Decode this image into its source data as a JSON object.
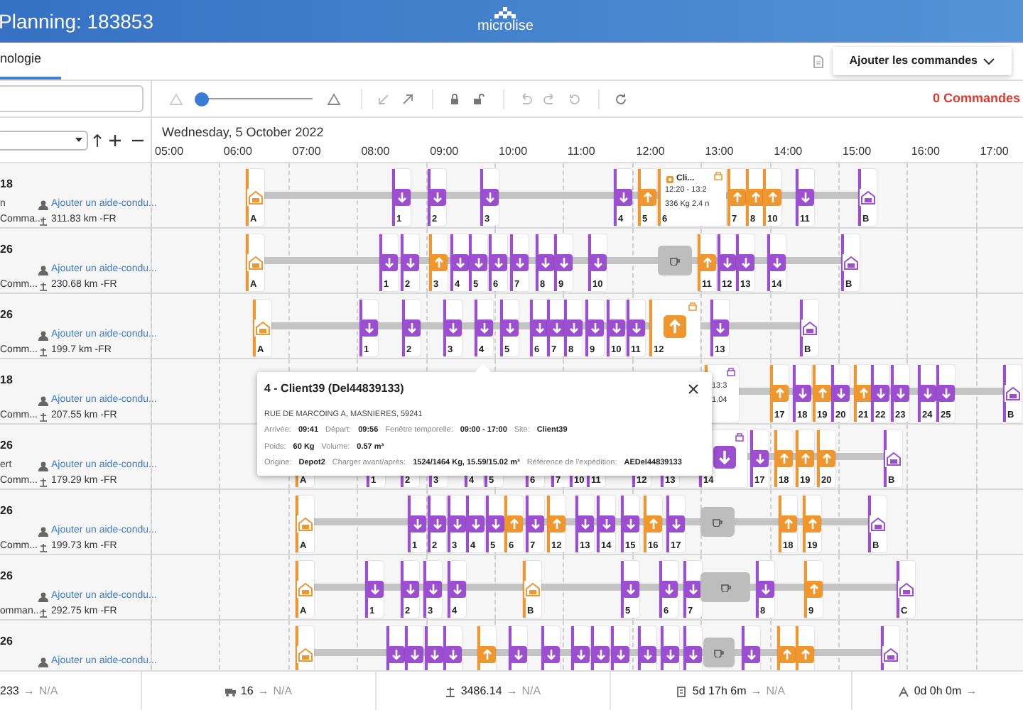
{
  "header": {
    "title": "Planning: 183853",
    "logo": "microlise"
  },
  "tabs": [
    {
      "label": "nologie",
      "selected": true
    }
  ],
  "add_orders_button": "Ajouter les commandes",
  "toolbar": {
    "zoom": {
      "level": 0
    },
    "orders_count": "0 Commandes"
  },
  "date": "Wednesday, 5 October 2022",
  "hours": [
    "05:00",
    "06:00",
    "07:00",
    "08:00",
    "09:00",
    "10:00",
    "11:00",
    "12:00",
    "13:00",
    "14:00",
    "15:00",
    "16:00",
    "17:00"
  ],
  "rows": [
    {
      "id": "18",
      "name": "n",
      "orders": "Comma...",
      "co_driver_link": "Ajouter un aide-condu...",
      "distance": "311.83 km -FR",
      "stops": [
        {
          "label": "A",
          "kind": "depot",
          "color": "#f0962f"
        },
        {
          "label": "1",
          "kind": "delivery"
        },
        {
          "label": "2",
          "kind": "delivery"
        },
        {
          "label": "3",
          "kind": "delivery"
        },
        {
          "label": "4",
          "kind": "delivery"
        },
        {
          "label": "5",
          "kind": "pickup"
        },
        {
          "label": "6",
          "kind": "detail",
          "title": "Cli...",
          "time": "12:20 - 13:2",
          "load": "336 Kg 2.4 n"
        },
        {
          "label": "7",
          "kind": "pickup"
        },
        {
          "label": "8",
          "kind": "pickup"
        },
        {
          "label": "10",
          "kind": "pickup"
        },
        {
          "label": "11",
          "kind": "delivery"
        },
        {
          "label": "B",
          "kind": "depot",
          "color": "#9b4fd0"
        }
      ]
    },
    {
      "id": "26",
      "orders": "Comm...",
      "co_driver_link": "Ajouter un aide-condu...",
      "distance": "230.68 km -FR",
      "stops": [
        {
          "label": "A",
          "kind": "depot",
          "color": "#f0962f"
        },
        {
          "label": "1",
          "kind": "delivery"
        },
        {
          "label": "2",
          "kind": "delivery"
        },
        {
          "label": "3",
          "kind": "pickup"
        },
        {
          "label": "4",
          "kind": "delivery"
        },
        {
          "label": "5",
          "kind": "delivery"
        },
        {
          "label": "6",
          "kind": "delivery"
        },
        {
          "label": "7",
          "kind": "delivery"
        },
        {
          "label": "8",
          "kind": "delivery"
        },
        {
          "label": "9",
          "kind": "delivery"
        },
        {
          "label": "10",
          "kind": "delivery"
        },
        {
          "kind": "break"
        },
        {
          "label": "11",
          "kind": "pickup"
        },
        {
          "label": "12",
          "kind": "delivery"
        },
        {
          "label": "13",
          "kind": "delivery"
        },
        {
          "label": "14",
          "kind": "delivery"
        },
        {
          "label": "B",
          "kind": "depot",
          "color": "#9b4fd0"
        }
      ]
    },
    {
      "id": "26",
      "orders": "Comm...",
      "co_driver_link": "Ajouter un aide-condu...",
      "distance": "199.7 km -FR",
      "stops": [
        {
          "label": "A",
          "kind": "depot",
          "color": "#f0962f"
        },
        {
          "label": "1",
          "kind": "delivery"
        },
        {
          "label": "2",
          "kind": "delivery"
        },
        {
          "label": "3",
          "kind": "delivery"
        },
        {
          "label": "4",
          "kind": "delivery"
        },
        {
          "label": "5",
          "kind": "delivery"
        },
        {
          "label": "6",
          "kind": "delivery"
        },
        {
          "label": "7",
          "kind": "delivery"
        },
        {
          "label": "8",
          "kind": "delivery"
        },
        {
          "label": "9",
          "kind": "delivery"
        },
        {
          "label": "10",
          "kind": "delivery"
        },
        {
          "label": "11",
          "kind": "delivery"
        },
        {
          "label": "12",
          "kind": "pickup",
          "wide": true
        },
        {
          "label": "13",
          "kind": "delivery"
        },
        {
          "label": "B",
          "kind": "depot",
          "color": "#9b4fd0"
        }
      ]
    },
    {
      "id": "18",
      "orders": "Comm...",
      "co_driver_link": "Ajouter un aide-condu...",
      "distance": "207.55 km -FR",
      "stops": [
        {
          "kind": "detail",
          "time": "13:3",
          "load": "1.04"
        },
        {
          "label": "17",
          "kind": "pickup"
        },
        {
          "label": "18",
          "kind": "delivery"
        },
        {
          "label": "19",
          "kind": "pickup"
        },
        {
          "label": "20",
          "kind": "delivery"
        },
        {
          "label": "21",
          "kind": "pickup"
        },
        {
          "label": "22",
          "kind": "delivery"
        },
        {
          "label": "23",
          "kind": "delivery"
        },
        {
          "label": "24",
          "kind": "delivery"
        },
        {
          "label": "25",
          "kind": "delivery"
        },
        {
          "label": "B",
          "kind": "depot",
          "color": "#9b4fd0"
        }
      ]
    },
    {
      "id": "26",
      "name": "ert",
      "orders": "Comm...",
      "co_driver_link": "Ajouter un aide-condu...",
      "distance": "179.29 km -FR",
      "stops": [
        {
          "label": "A",
          "kind": "depot",
          "color": "#f0962f"
        },
        {
          "label": "1",
          "kind": "delivery"
        },
        {
          "label": "2",
          "kind": "delivery"
        },
        {
          "label": "3",
          "kind": "delivery"
        },
        {
          "label": "4",
          "kind": "delivery"
        },
        {
          "label": "5",
          "kind": "delivery"
        },
        {
          "label": "6",
          "kind": "delivery"
        },
        {
          "label": "7",
          "kind": "delivery"
        },
        {
          "label": "10",
          "kind": "delivery"
        },
        {
          "label": "11",
          "kind": "delivery"
        },
        {
          "label": "12",
          "kind": "delivery"
        },
        {
          "label": "13",
          "kind": "delivery"
        },
        {
          "label": "14",
          "kind": "delivery",
          "wide": true
        },
        {
          "label": "17",
          "kind": "delivery"
        },
        {
          "label": "18",
          "kind": "pickup"
        },
        {
          "label": "19",
          "kind": "pickup"
        },
        {
          "label": "20",
          "kind": "pickup"
        },
        {
          "label": "B",
          "kind": "depot",
          "color": "#9b4fd0"
        }
      ]
    },
    {
      "id": "26",
      "orders": "Comm...",
      "co_driver_link": "Ajouter un aide-condu...",
      "distance": "199.73 km -FR",
      "stops": [
        {
          "label": "A",
          "kind": "depot",
          "color": "#f0962f"
        },
        {
          "label": "1",
          "kind": "delivery"
        },
        {
          "label": "2",
          "kind": "delivery"
        },
        {
          "label": "3",
          "kind": "delivery"
        },
        {
          "label": "4",
          "kind": "delivery"
        },
        {
          "label": "5",
          "kind": "delivery"
        },
        {
          "label": "6",
          "kind": "pickup"
        },
        {
          "label": "7",
          "kind": "delivery"
        },
        {
          "label": "12",
          "kind": "pickup"
        },
        {
          "label": "13",
          "kind": "delivery"
        },
        {
          "label": "14",
          "kind": "delivery"
        },
        {
          "label": "15",
          "kind": "delivery"
        },
        {
          "label": "16",
          "kind": "pickup"
        },
        {
          "label": "17",
          "kind": "delivery"
        },
        {
          "kind": "break"
        },
        {
          "label": "18",
          "kind": "pickup"
        },
        {
          "label": "19",
          "kind": "pickup"
        },
        {
          "label": "B",
          "kind": "depot",
          "color": "#9b4fd0"
        }
      ]
    },
    {
      "id": "26",
      "orders": "omman...",
      "co_driver_link": "Ajouter un aide-condu...",
      "distance": "292.75 km -FR",
      "stops": [
        {
          "label": "A",
          "kind": "depot",
          "color": "#f0962f"
        },
        {
          "label": "1",
          "kind": "delivery"
        },
        {
          "label": "2",
          "kind": "delivery"
        },
        {
          "label": "3",
          "kind": "delivery"
        },
        {
          "label": "4",
          "kind": "delivery"
        },
        {
          "label": "B",
          "kind": "depot",
          "color": "#f0962f"
        },
        {
          "label": "5",
          "kind": "delivery"
        },
        {
          "label": "6",
          "kind": "delivery"
        },
        {
          "label": "7",
          "kind": "delivery"
        },
        {
          "kind": "break"
        },
        {
          "label": "8",
          "kind": "delivery"
        },
        {
          "label": "9",
          "kind": "pickup"
        },
        {
          "label": "C",
          "kind": "depot",
          "color": "#9b4fd0"
        }
      ]
    },
    {
      "id": "26",
      "co_driver_link": "Ajouter un aide-condu...",
      "stops": [
        {
          "kind": "depot",
          "color": "#f0962f"
        },
        {
          "kind": "delivery"
        },
        {
          "kind": "delivery"
        },
        {
          "kind": "delivery"
        },
        {
          "kind": "delivery"
        },
        {
          "kind": "pickup"
        },
        {
          "kind": "delivery"
        },
        {
          "kind": "delivery"
        },
        {
          "kind": "delivery"
        },
        {
          "kind": "delivery"
        },
        {
          "kind": "delivery"
        },
        {
          "kind": "delivery"
        },
        {
          "kind": "delivery"
        },
        {
          "kind": "delivery"
        },
        {
          "kind": "break"
        },
        {
          "kind": "delivery"
        },
        {
          "kind": "pickup"
        },
        {
          "kind": "pickup"
        },
        {
          "kind": "depot",
          "color": "#9b4fd0"
        }
      ]
    }
  ],
  "tooltip": {
    "title": "4 - Client39 (Del44839133)",
    "address": "RUE DE MARCOING A, MASNIERES, 59241",
    "lines": [
      [
        {
          "label": "Arrivée:",
          "value": "09:41"
        },
        {
          "label": "Départ:",
          "value": "09:56"
        },
        {
          "label": "Fenêtre temporelle:",
          "value": "09:00 - 17:00"
        },
        {
          "label": "Site:",
          "value": "Client39"
        }
      ],
      [
        {
          "label": "Poids:",
          "value": "60 Kg"
        },
        {
          "label": "Volume:",
          "value": "0.57 m³"
        }
      ],
      [
        {
          "label": "Origine:",
          "value": "Depot2"
        },
        {
          "label": "Charger avant/après:",
          "value": "1524/1464 Kg, 15.59/15.02 m³"
        },
        {
          "label": "Référence de l'expédition:",
          "value": "AEDel44839133"
        }
      ]
    ]
  },
  "footer": [
    {
      "kind": "count",
      "value": "233",
      "arrow": "→",
      "target": "N/A"
    },
    {
      "kind": "vehicles",
      "value": "16",
      "arrow": "→",
      "target": "N/A"
    },
    {
      "kind": "distance",
      "value": "3486.14",
      "arrow": "→",
      "target": "N/A"
    },
    {
      "kind": "duration",
      "value": "5d 17h 6m",
      "arrow": "→",
      "target": "N/A"
    },
    {
      "kind": "idle",
      "value": "0d 0h 0m",
      "arrow": "→"
    }
  ]
}
